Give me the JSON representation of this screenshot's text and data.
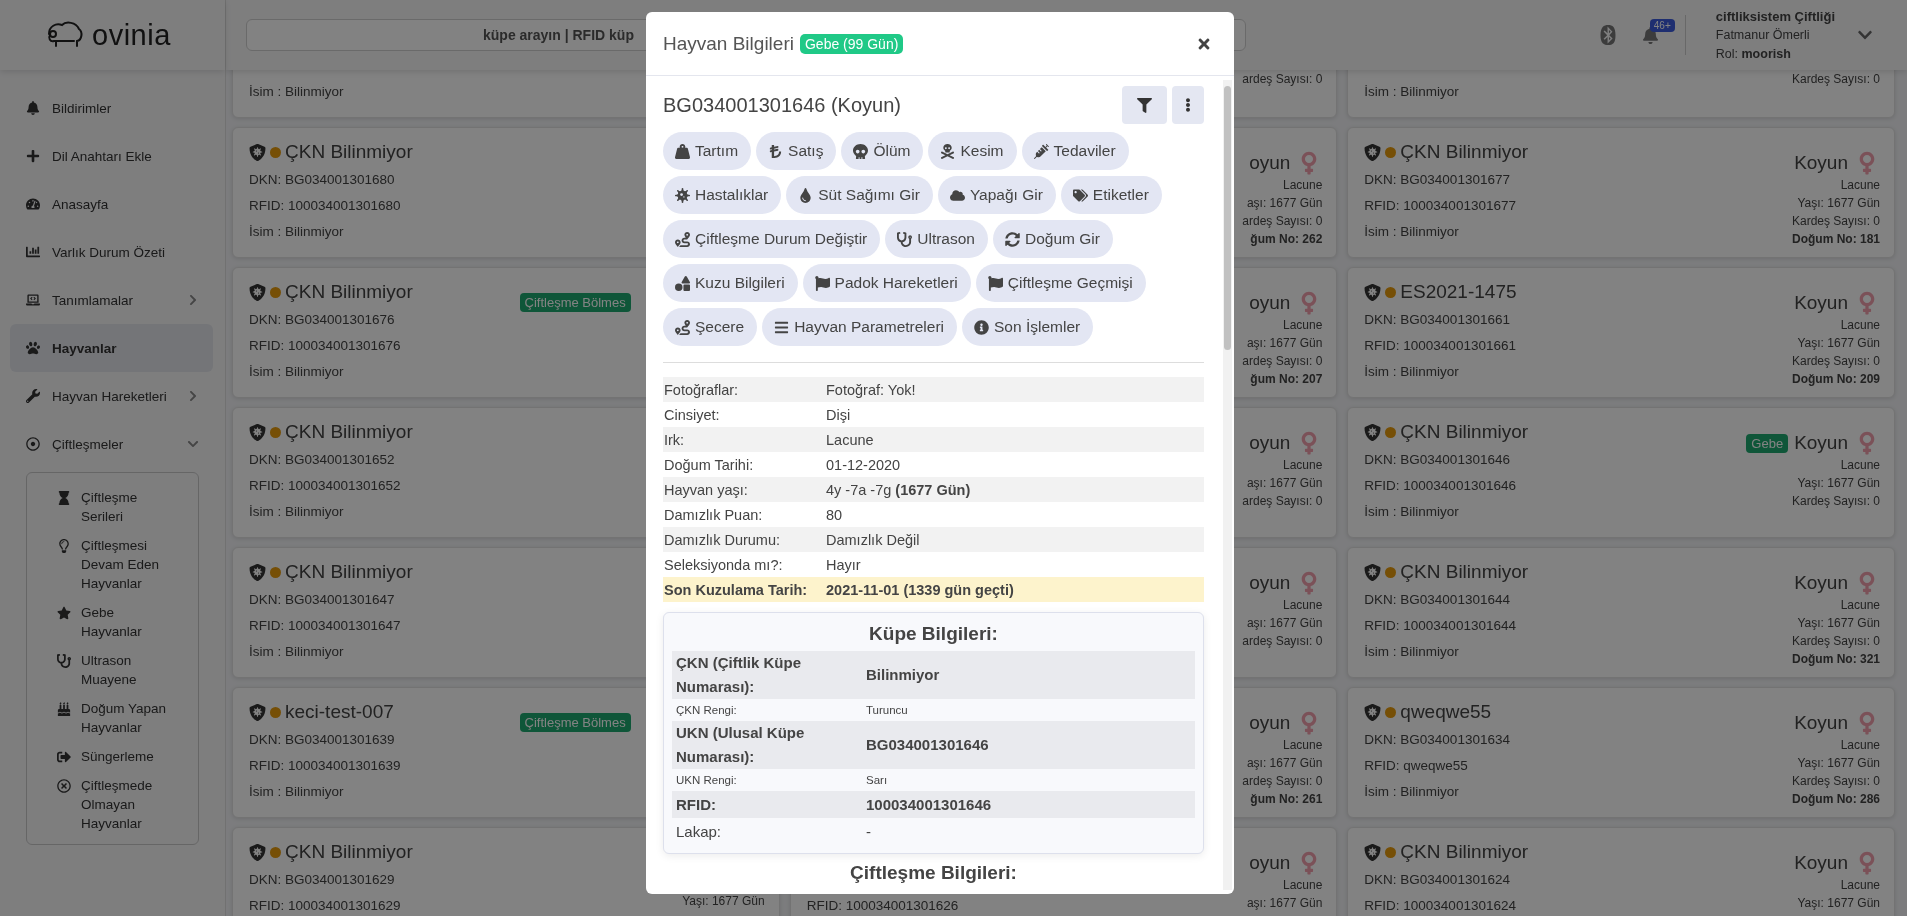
{
  "sidebar": {
    "logo": "ovinia",
    "items": [
      {
        "label": "Bildirimler",
        "selected": false
      },
      {
        "label": "Dil Anahtarı Ekle",
        "selected": false
      },
      {
        "label": "Anasayfa",
        "selected": false
      },
      {
        "label": "Varlık Durum Özeti",
        "selected": false
      },
      {
        "label": "Tanımlamalar",
        "selected": false,
        "expanded": false
      },
      {
        "label": "Hayvanlar",
        "selected": true
      },
      {
        "label": "Hayvan Hareketleri",
        "selected": false,
        "expanded": false
      },
      {
        "label": "Çiftleşmeler",
        "selected": false,
        "expanded": true,
        "children": [
          {
            "label": "Çiftleşme Serileri",
            "selected": false
          },
          {
            "label": "Çiftleşmesi Devam Eden Hayvanlar",
            "selected": false
          },
          {
            "label": "Gebe Hayvanlar",
            "selected": false
          },
          {
            "label": "Ultrason Muayene",
            "selected": false
          },
          {
            "label": "Doğum Yapan Hayvanlar",
            "selected": false
          },
          {
            "label": "Süngerleme",
            "selected": false
          },
          {
            "label": "Çiftleşmede Olmayan Hayvanlar",
            "selected": false
          }
        ]
      }
    ]
  },
  "topbar": {
    "search": {
      "placeholder": "küpe arayın | RFID küp"
    },
    "notifications": "46+",
    "user": {
      "farm": "ciftliksistem Çiftliği",
      "name": "Fatmanur Ömerli",
      "role": "Rol: **moorish**"
    }
  },
  "card_columns": [
    [
      {
        "name": "İsim : Bilinmiyor"
      },
      {
        "title": "ÇKN Bilinmiyor",
        "color": "#764f06",
        "dkn": "DKN: BG034001301680",
        "rfid": "RFID: 100034001301680",
        "name": "İsim : Bilinmiyor"
      },
      {
        "title": "ÇKN Bilinmiyor",
        "color": "#764f06",
        "dkn": "DKN: BG034001301676",
        "rfid": "RFID: 100034001301676",
        "name": "İsim : Bilinmiyor",
        "badge": "Çiftleşme Bölmes"
      },
      {
        "title": "ÇKN Bilinmiyor",
        "color": "#764f06",
        "dkn": "DKN: BG034001301652",
        "rfid": "RFID: 100034001301652",
        "name": "İsim : Bilinmiyor"
      },
      {
        "title": "ÇKN Bilinmiyor",
        "color": "#764f06",
        "dkn": "DKN: BG034001301647",
        "rfid": "RFID: 100034001301647",
        "name": "İsim : Bilinmiyor"
      },
      {
        "title": "keci-test-007",
        "color": "#764f06",
        "dkn": "DKN: BG034001301639",
        "rfid": "RFID: 100034001301639",
        "name": "İsim : Bilinmiyor",
        "badge": "Çiftleşme Bölmes"
      },
      {
        "title": "ÇKN Bilinmiyor",
        "color": "#764f06",
        "dkn": "DKN: BG034001301629",
        "rfid": "RFID: 100034001301629",
        "age": "Yaşı: 1677 Gün"
      }
    ],
    [
      {
        "siblings": "ardeş Sayısı: 0"
      },
      {
        "species": "oyun",
        "breed": "Lacune",
        "age": "aşı: 1677 Gün",
        "siblings": "ardeş Sayısı: 0",
        "birth_no": "ğum No: 262"
      },
      {
        "species": "oyun",
        "breed": "Lacune",
        "age": "aşı: 1677 Gün",
        "siblings": "ardeş Sayısı: 0",
        "birth_no": "ğum No: 207"
      },
      {
        "species": "oyun",
        "breed": "Lacune",
        "age": "aşı: 1677 Gün",
        "siblings": "ardeş Sayısı: 0"
      },
      {
        "species": "oyun",
        "breed": "Lacune",
        "age": "aşı: 1677 Gün",
        "siblings": "ardeş Sayısı: 0"
      },
      {
        "species": "oyun",
        "breed": "Lacune",
        "age": "aşı: 1677 Gün",
        "siblings": "ardeş Sayısı: 0",
        "birth_no": "ğum No: 261"
      },
      {
        "rfid": "RFID: 100034001301626",
        "species": "oyun",
        "breed": "Lacune",
        "age": "aşı: 1677 Gün"
      }
    ],
    [
      {
        "name": "İsim : Bilinmiyor",
        "siblings": "Kardeş Sayısı: 0"
      },
      {
        "title": "ÇKN Bilinmiyor",
        "color": "#764f06",
        "dkn": "DKN: BG034001301677",
        "rfid": "RFID: 100034001301677",
        "name": "İsim : Bilinmiyor",
        "species": "Koyun",
        "breed": "Lacune",
        "age": "Yaşı: 1677 Gün",
        "siblings": "Kardeş Sayısı: 0",
        "birth_no": "Doğum No: 181"
      },
      {
        "title": "ES2021-1475",
        "color": "#764f06",
        "dkn": "DKN: BG034001301661",
        "rfid": "RFID: 100034001301661",
        "name": "İsim : Bilinmiyor",
        "species": "Koyun",
        "breed": "Lacune",
        "age": "Yaşı: 1677 Gün",
        "siblings": "Kardeş Sayısı: 0",
        "birth_no": "Doğum No: 209"
      },
      {
        "title": "ÇKN Bilinmiyor",
        "color": "#764f06",
        "dkn": "DKN: BG034001301646",
        "rfid": "RFID: 100034001301646",
        "name": "İsim : Bilinmiyor",
        "status": "Gebe",
        "species": "Koyun",
        "breed": "Lacune",
        "age": "Yaşı: 1677 Gün",
        "siblings": "Kardeş Sayısı: 0"
      },
      {
        "title": "ÇKN Bilinmiyor",
        "color": "#764f06",
        "dkn": "DKN: BG034001301644",
        "rfid": "RFID: 100034001301644",
        "name": "İsim : Bilinmiyor",
        "species": "Koyun",
        "breed": "Lacune",
        "age": "Yaşı: 1677 Gün",
        "siblings": "Kardeş Sayısı: 0",
        "birth_no": "Doğum No: 321"
      },
      {
        "title": "qweqwe55",
        "color": "#764f06",
        "dkn": "DKN: BG034001301634",
        "rfid": "RFID: qweqwe55",
        "name": "İsim : Bilinmiyor",
        "species": "Koyun",
        "breed": "Lacune",
        "age": "Yaşı: 1677 Gün",
        "siblings": "Kardeş Sayısı: 0",
        "birth_no": "Doğum No: 286"
      },
      {
        "title": "ÇKN Bilinmiyor",
        "color": "#764f06",
        "dkn": "DKN: BG034001301624",
        "rfid": "RFID: 100034001301624",
        "species": "Koyun",
        "breed": "Lacune",
        "age": "Yaşı: 1677 Gün"
      }
    ]
  ],
  "modal": {
    "title": "Hayvan Bilgileri",
    "badge": "Gebe (99 Gün)",
    "animal": "BG034001301646 (Koyun)",
    "action_rows": [
      [
        "Tartım",
        "Satış",
        "Ölüm",
        "Kesim",
        "Tedaviler"
      ],
      [
        "Hastalıklar",
        "Süt Sağımı Gir",
        "Yapağı Gir",
        "Etiketler"
      ],
      [
        "Çiftleşme Durum Değiştir",
        "Ultrason",
        "Doğum Gir"
      ],
      [
        "Kuzu Bilgileri",
        "Padok Hareketleri",
        "Çiftleşme Geçmişi"
      ],
      [
        "Şecere",
        "Hayvan Parametreleri",
        "Son İşlemler"
      ]
    ],
    "info": [
      {
        "label": "Fotoğraflar:",
        "value": "Fotoğraf: Yok!",
        "highlighted": false
      },
      {
        "label": "Cinsiyet:",
        "value": "Dişi",
        "highlighted": false
      },
      {
        "label": "Irk:",
        "value": "Lacune",
        "highlighted": false
      },
      {
        "label": "Doğum Tarihi:",
        "value": "01-12-2020",
        "highlighted": false
      },
      {
        "label": "Hayvan yaşı:",
        "value": "4y -7a -7g **(1677 Gün)**",
        "highlighted": false
      },
      {
        "label": "Damızlık Puan:",
        "value": "80",
        "highlighted": false
      },
      {
        "label": "Damızlık Durumu:",
        "value": "Damızlık Değil",
        "highlighted": false
      },
      {
        "label": "Seleksiyonda mı?:",
        "value": "Hayır",
        "highlighted": false
      },
      {
        "label": "Son Kuzulama Tarih:",
        "value": "2021-11-01 (1339 gün geçti)",
        "highlighted": true
      }
    ],
    "tag_section": {
      "title": "Küpe Bilgileri:",
      "rows": [
        {
          "kind": "primary",
          "label": "ÇKN (Çiftlik Küpe Numarası):",
          "value": "Bilinmiyor"
        },
        {
          "kind": "secondary",
          "label": "ÇKN Rengi:",
          "value": "Turuncu"
        },
        {
          "kind": "primary",
          "label": "UKN (Ulusal Küpe Numarası):",
          "value": "BG034001301646"
        },
        {
          "kind": "secondary",
          "label": "UKN Rengi:",
          "value": "Sarı"
        },
        {
          "kind": "primary",
          "label": "RFID:",
          "value": "100034001301646"
        },
        {
          "kind": "plain",
          "label": "Lakap:",
          "value": "-"
        }
      ]
    },
    "next_section": "Çiftleşme Bilgileri:"
  }
}
